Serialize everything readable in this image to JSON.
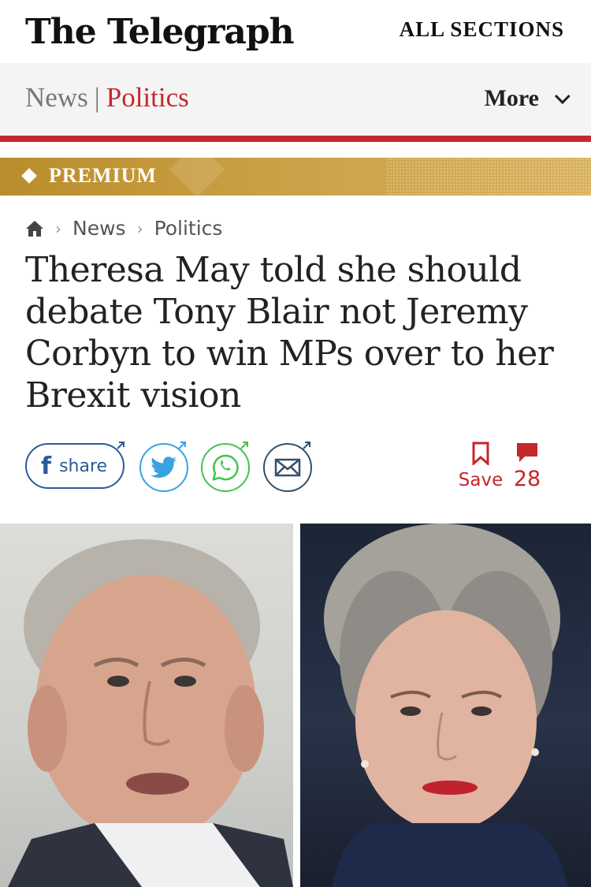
{
  "masthead": {
    "logo": "The Telegraph",
    "all_sections": "ALL SECTIONS"
  },
  "sectionbar": {
    "news": "News",
    "separator": "|",
    "politics": "Politics",
    "more": "More"
  },
  "premium": {
    "label": "PREMIUM"
  },
  "breadcrumb": {
    "items": [
      "News",
      "Politics"
    ]
  },
  "article": {
    "headline": "Theresa May told she should debate Tony Blair not Jeremy Corbyn to win MPs over to her Brexit vision"
  },
  "share": {
    "share_label": "share"
  },
  "actions": {
    "save_label": "Save",
    "comment_count": "28"
  },
  "colors": {
    "brand_red": "#c5272c",
    "premium_gold": "#caa045",
    "facebook": "#2a5b99",
    "twitter": "#3aa1e3",
    "whatsapp": "#43c352",
    "email": "#34506b"
  }
}
